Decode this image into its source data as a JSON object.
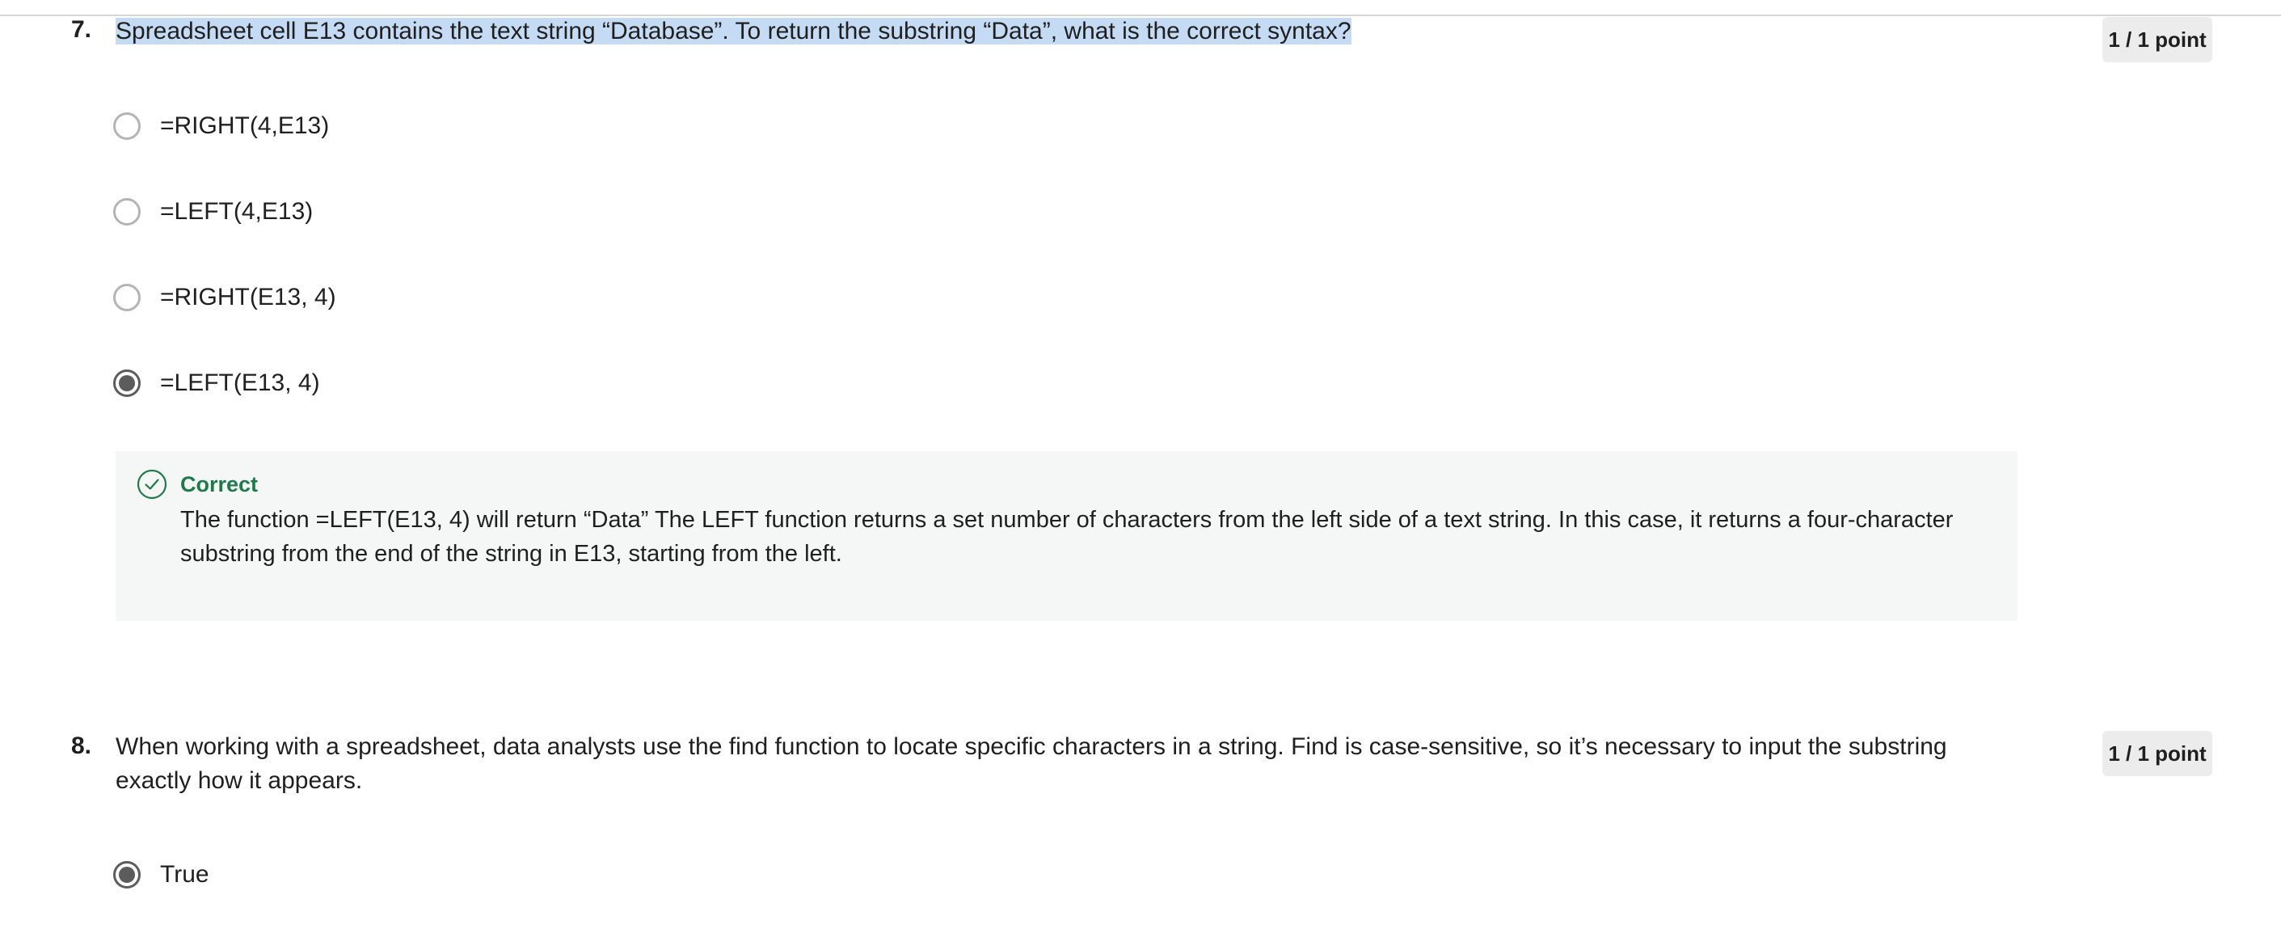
{
  "questions": [
    {
      "number": "7.",
      "text": "Spreadsheet cell E13 contains the text string “Database”. To return the substring “Data”, what is the correct syntax?",
      "points": "1 / 1 point",
      "options": [
        {
          "label": "=RIGHT(4,E13)",
          "selected": false
        },
        {
          "label": "=LEFT(4,E13)",
          "selected": false
        },
        {
          "label": "=RIGHT(E13, 4)",
          "selected": false
        },
        {
          "label": "=LEFT(E13, 4)",
          "selected": true
        }
      ],
      "feedback": {
        "status": "Correct",
        "status_color": "#1e7a4a",
        "icon": "check-circle-icon",
        "text": "The function =LEFT(E13, 4) will return “Data” The LEFT function returns a set number of characters from the left side of a text string. In this case, it returns a four-character substring from the end of the string in E13, starting from the left."
      }
    },
    {
      "number": "8.",
      "text": "When working with a spreadsheet, data analysts use the find function to locate specific characters in a string. Find is case-sensitive, so it’s necessary to input the substring exactly how it appears.",
      "points": "1 / 1 point",
      "options": [
        {
          "label": "True",
          "selected": true
        }
      ]
    }
  ],
  "colors": {
    "highlight": "#c4dbf3",
    "badge_bg": "#ececec",
    "feedback_bg": "#f5f7f6",
    "radio_selected": "#5c5c5c",
    "radio_unselected": "#b4b4b4"
  }
}
